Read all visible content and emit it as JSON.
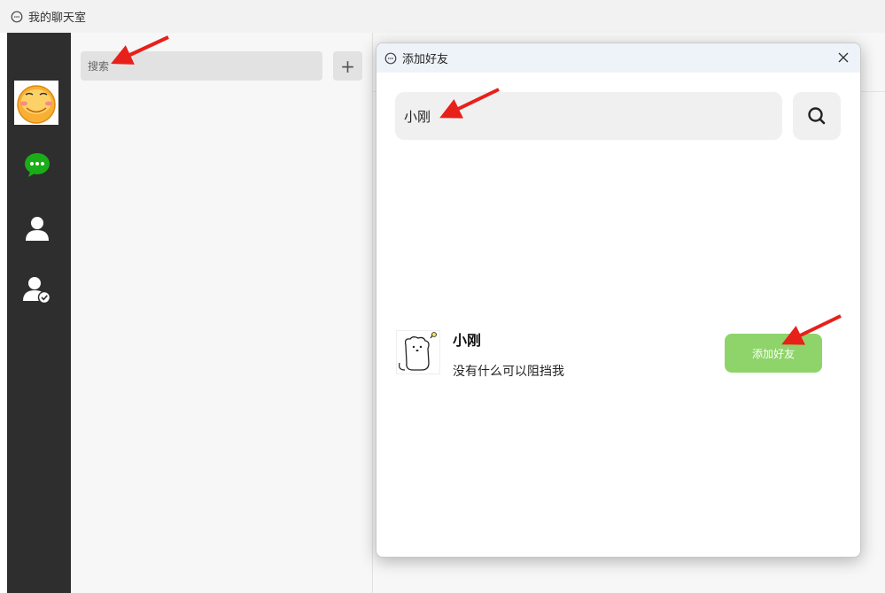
{
  "window": {
    "title": "我的聊天室"
  },
  "sidebar": {
    "avatar_icon": "smiley-avatar-icon",
    "items": [
      {
        "name": "chat",
        "icon": "chat-bubble-icon",
        "active": true,
        "color": "#1aad19"
      },
      {
        "name": "contacts",
        "icon": "person-icon",
        "active": false,
        "color": "#ffffff"
      },
      {
        "name": "friend-requests",
        "icon": "person-check-icon",
        "active": false,
        "color": "#ffffff"
      }
    ]
  },
  "list_pane": {
    "search": {
      "placeholder": "搜索",
      "value": ""
    },
    "add_button_label": "+"
  },
  "dialog": {
    "title": "添加好友",
    "close_label": "✕",
    "search_input": {
      "value": "小刚"
    },
    "result": {
      "name": "小刚",
      "signature": "没有什么可以阻挡我",
      "add_button_label": "添加好友"
    }
  },
  "colors": {
    "accent_green": "#8fd46a",
    "rail_bg": "#2e2e2e",
    "annotation_red": "#e8201a"
  }
}
